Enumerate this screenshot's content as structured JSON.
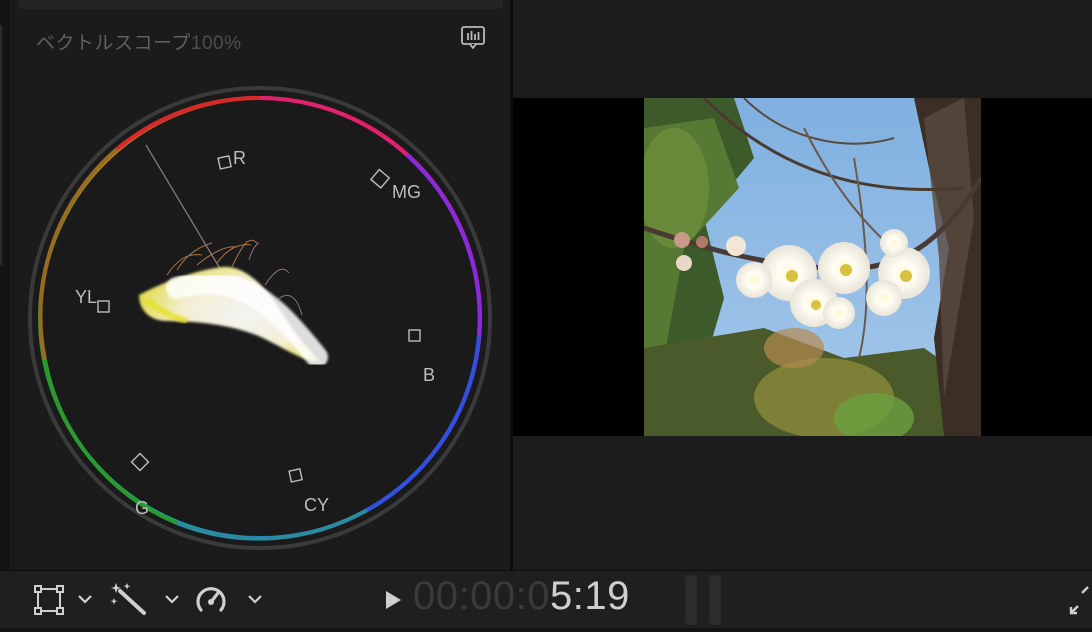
{
  "scope": {
    "title": "ベクトルスコープ",
    "scale": "100%",
    "targets": [
      {
        "label": "R"
      },
      {
        "label": "MG"
      },
      {
        "label": "B"
      },
      {
        "label": "CY"
      },
      {
        "label": "G"
      },
      {
        "label": "YL"
      }
    ],
    "icon": "waveform-settings-icon"
  },
  "viewer": {
    "image": "white plum blossoms on branch against blue sky"
  },
  "toolbar": {
    "transform_icon": "transform-icon",
    "enhance_icon": "magic-wand-icon",
    "speed_icon": "speedometer-icon",
    "timecode_dim": "00:00:0",
    "timecode_lit": "5:19",
    "fullscreen_icon": "fullscreen-icon"
  },
  "colors": {
    "background": "#1b1b1b",
    "timecode": "#cfcfcf",
    "timecode_dim": "#3a3a3a",
    "label": "#bdbdbd"
  }
}
